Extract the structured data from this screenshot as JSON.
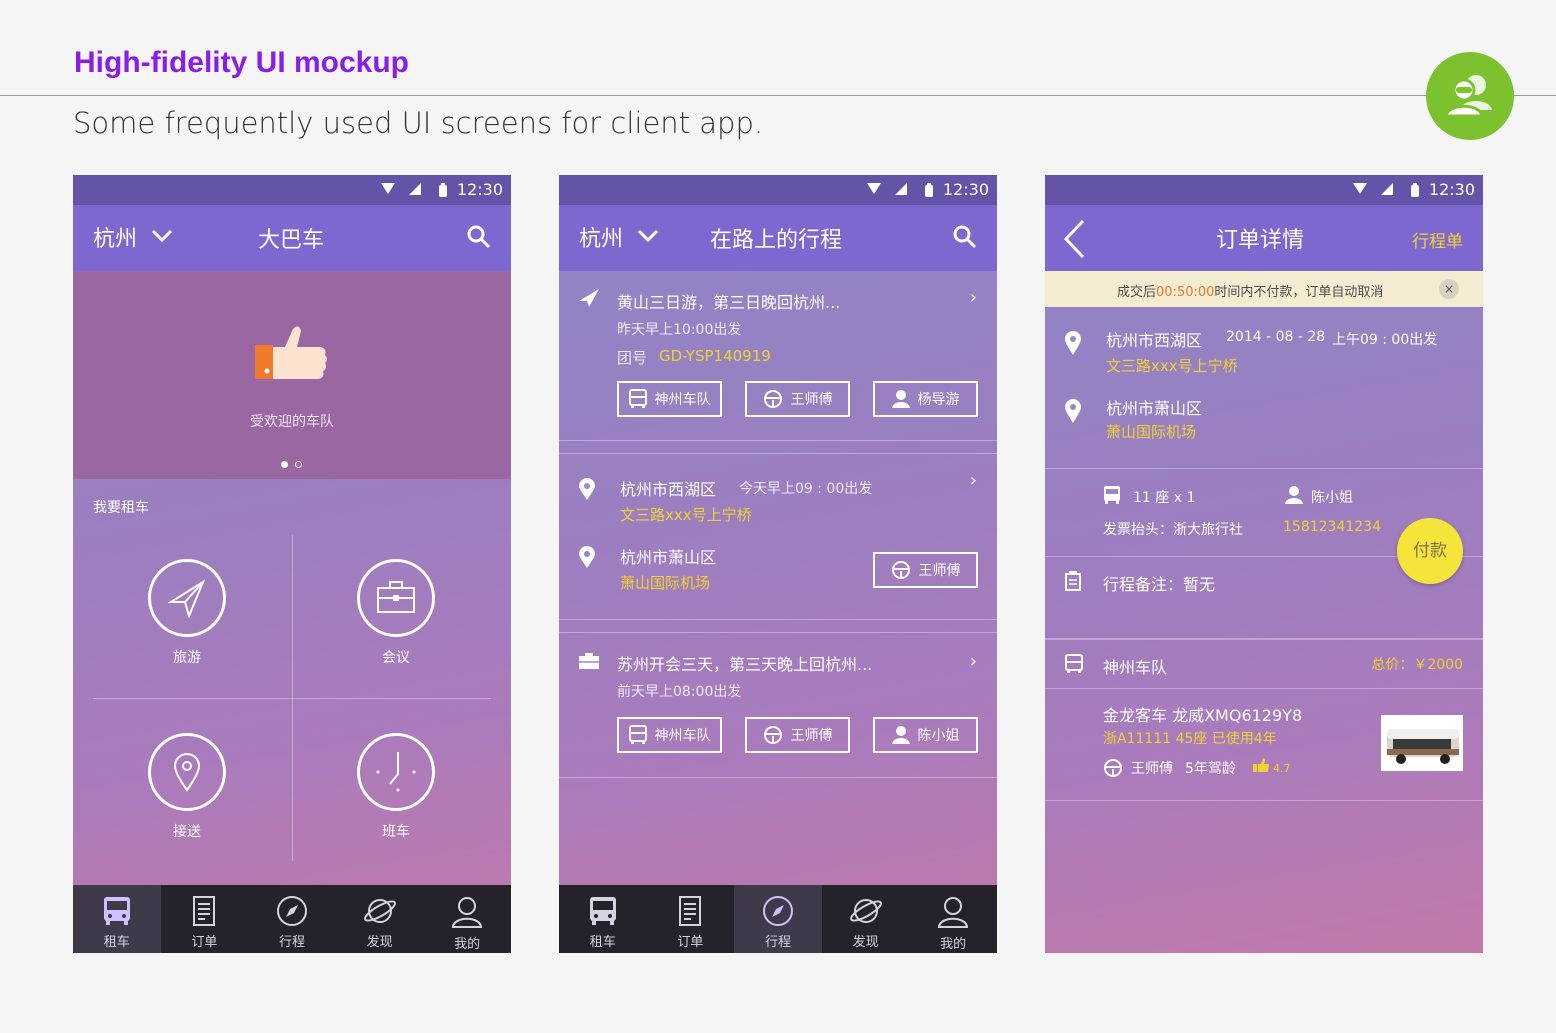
{
  "header": {
    "title": "High-fidelity UI mockup",
    "subtitle": "Some frequently used UI screens for client app."
  },
  "status_time": "12:30",
  "screen1": {
    "city": "杭州",
    "title": "大巴车",
    "hero_caption": "受欢迎的车队",
    "rent_label": "我要租车",
    "categories": [
      {
        "label": "旅游",
        "icon": "paper-plane-icon"
      },
      {
        "label": "会议",
        "icon": "briefcase-icon"
      },
      {
        "label": "接送",
        "icon": "location-pin-icon"
      },
      {
        "label": "班车",
        "icon": "clock-icon"
      }
    ]
  },
  "screen2": {
    "city": "杭州",
    "title": "在路上的行程",
    "trip1": {
      "title": "黄山三日游，第三日晚回杭州...",
      "depart": "昨天早上10:00出发",
      "group_label": "团号",
      "group_no": "GD-YSP140919",
      "team": "神州车队",
      "driver": "王师傅",
      "guide": "杨导游"
    },
    "trip2": {
      "from_city": "杭州市西湖区",
      "from_time": "今天早上09 : 00出发",
      "from_addr": "文三路xxx号上宁桥",
      "to_city": "杭州市萧山区",
      "to_addr": "萧山国际机场",
      "driver": "王师傅"
    },
    "trip3": {
      "title": "苏州开会三天，第三天晚上回杭州...",
      "depart": "前天早上08:00出发",
      "team": "神州车队",
      "driver": "王师傅",
      "contact": "陈小姐"
    }
  },
  "screen3": {
    "title": "订单详情",
    "action": "行程单",
    "banner_prefix": "成交后",
    "banner_time": "00:50:00",
    "banner_suffix": "时间内不付款，订单自动取消",
    "banner_close": "×",
    "from_city": "杭州市西湖区",
    "date": "2014 - 08 - 28",
    "time": "上午09 : 00出发",
    "from_addr": "文三路xxx号上宁桥",
    "to_city": "杭州市萧山区",
    "to_addr": "萧山国际机场",
    "seats": "11 座 x 1",
    "contact": "陈小姐",
    "invoice": "发票抬头：浙大旅行社",
    "phone": "15812341234",
    "pay": "付款",
    "note": "行程备注：暂无",
    "team": "神州车队",
    "total": "总价：￥2000",
    "bus_name": "金龙客车 龙威XMQ6129Y8",
    "bus_info": "浙A11111  45座  已使用4年",
    "driver": "王师傅",
    "driver_exp": "5年驾龄",
    "rating": "4.7"
  },
  "tabs": [
    {
      "label": "租车",
      "icon": "bus-icon"
    },
    {
      "label": "订单",
      "icon": "document-icon"
    },
    {
      "label": "行程",
      "icon": "compass-icon"
    },
    {
      "label": "发现",
      "icon": "planet-icon"
    },
    {
      "label": "我的",
      "icon": "user-icon"
    }
  ],
  "colors": {
    "heading": "#8a1ee6",
    "badge": "#7cc22e",
    "status_bar": "#6354a8",
    "top_bar": "#7c68cf",
    "tab_bar": "#25222b",
    "accent_yellow": "#f2d233",
    "pay_button": "#f5e53a"
  }
}
